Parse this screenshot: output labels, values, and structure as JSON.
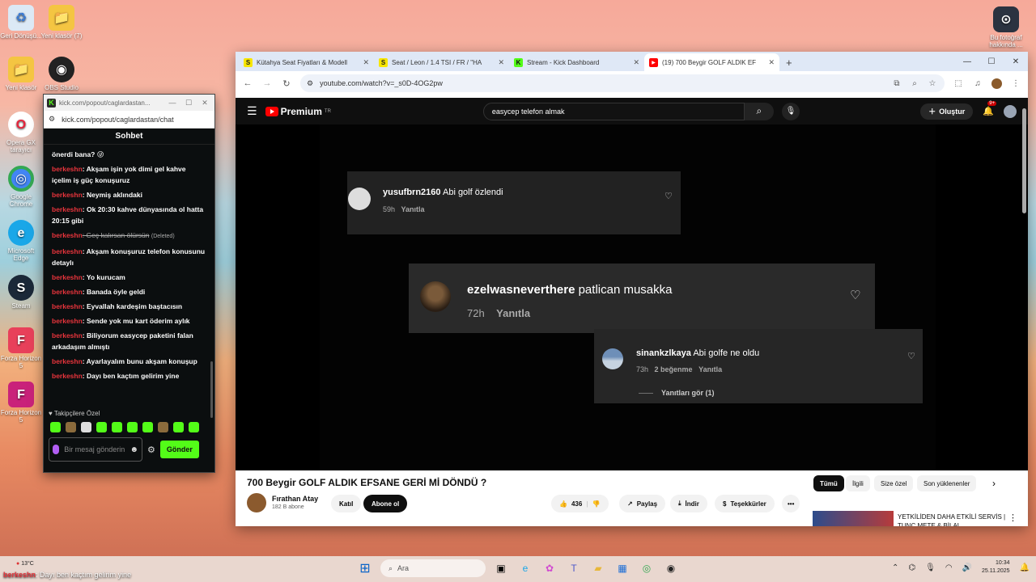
{
  "desktop": {
    "icons": [
      {
        "label": "Geri Dönüşü...",
        "symbol": "♻"
      },
      {
        "label": "Yeni klasör (7)",
        "symbol": "📁"
      },
      {
        "label": "Yeni klasör",
        "symbol": "📁"
      },
      {
        "label": "OBS Studio",
        "symbol": "◉"
      },
      {
        "label": "Opera GX tarayıcı",
        "symbol": "O"
      },
      {
        "label": "Google Chrome",
        "symbol": "◎"
      },
      {
        "label": "Microsoft Edge",
        "symbol": "e"
      },
      {
        "label": "Steam",
        "symbol": "S"
      },
      {
        "label": "Forza Horizon 5",
        "symbol": "F"
      },
      {
        "label": "Forza Horizon 5",
        "symbol": "F"
      },
      {
        "label": "Bu fotoğraf hakkında ...",
        "symbol": "⊙"
      }
    ]
  },
  "chat": {
    "window_title": "kick.com/popout/caglardastan...",
    "url": "kick.com/popout/caglardastan/chat",
    "header": "Sohbet",
    "first_line": "önerdi bana? 😜",
    "messages": [
      {
        "user": "berkeshn",
        "text": ": Akşam işin yok dimi gel kahve içelim iş güç konuşuruz"
      },
      {
        "user": "berkeshn",
        "text": ": Neymiş aklındaki"
      },
      {
        "user": "berkeshn",
        "text": ": Ok 20:30 kahve dünyasında ol hatta 20:15 gibi"
      },
      {
        "user": "berkeshn",
        "text": ": Geç kalırsan ölürsün",
        "deleted_tag": "(Deleted)"
      },
      {
        "user": "berkeshn",
        "text": ": Akşam konuşuruz telefon konusunu detaylı"
      },
      {
        "user": "berkeshn",
        "text": ": Yo kurucam"
      },
      {
        "user": "berkeshn",
        "text": ": Banada öyle geldi"
      },
      {
        "user": "berkeshn",
        "text": ": Eyvallah kardeşim baştacısın"
      },
      {
        "user": "berkeshn",
        "text": ": Sende yok mu kart öderim aylık"
      },
      {
        "user": "berkeshn",
        "text": ": Biliyorum easycep paketini falan arkadaşım almıştı"
      },
      {
        "user": "berkeshn",
        "text": ": Ayarlayalım bunu akşam konuşup"
      },
      {
        "user": "berkeshn",
        "text": ": Dayı ben kaçtım gelirim yine"
      }
    ],
    "followers_label": "♥ Takipçilere Özel",
    "input_placeholder": "Bir mesaj gönderin",
    "send_label": "Gönder"
  },
  "browser": {
    "tabs": [
      {
        "favicon": "S",
        "title": "Kütahya Seat Fiyatları & Modell",
        "close": "✕"
      },
      {
        "favicon": "S",
        "title": "Seat / Leon / 1.4 TSI / FR / \"HA",
        "close": "✕"
      },
      {
        "favicon": "K",
        "title": "Stream - Kick Dashboard",
        "close": "✕"
      },
      {
        "favicon": "▶",
        "title": "(19) 700 Beygir GOLF ALDIK EF",
        "close": "✕"
      }
    ],
    "new_tab": "+",
    "url": "youtube.com/watch?v=_s0D-4OG2pw"
  },
  "youtube": {
    "logo_text": "Premium",
    "logo_sup": "TR",
    "search_value": "easycep telefon almak",
    "create_label": "Oluştur",
    "notif_count": "9+",
    "comments": [
      {
        "name": "yusufbrn2160",
        "text": "Abi golf özlendi",
        "time": "59h",
        "reply": "Yanıtla"
      },
      {
        "name": "ezelwasneverthere",
        "text": "patlican musakka",
        "time": "72h",
        "reply": "Yanıtla"
      },
      {
        "name": "sinankzlkaya",
        "text": "Abi golfe ne oldu",
        "time": "73h",
        "likes": "2 beğenme",
        "reply": "Yanıtla",
        "view_replies": "Yanıtları gör (1)"
      }
    ],
    "video_title": "700 Beygir GOLF ALDIK EFSANE GERİ Mİ DÖNDÜ ?",
    "channel_name": "Fırathan Atay",
    "channel_subs": "182 B abone",
    "join_label": "Katıl",
    "subscribe_label": "Abone ol",
    "like_count": "436",
    "share_label": "Paylaş",
    "download_label": "İndir",
    "thanks_label": "Teşekkürler",
    "more_label": "•••",
    "chips": [
      "Tümü",
      "İlgili",
      "Size özel",
      "Son yüklenenler"
    ],
    "recommended_title": "YETKİLİDEN DAHA ETKİLİ SERVİS | TUNÇ METE & BİLAL"
  },
  "taskbar": {
    "weather": "13°C",
    "ticker_user": "berkeshn",
    "ticker_text": ": Dayı ben kaçtım gelirim yine",
    "search_placeholder": "Ara",
    "time": "10:34",
    "date": "25.11.2025"
  }
}
